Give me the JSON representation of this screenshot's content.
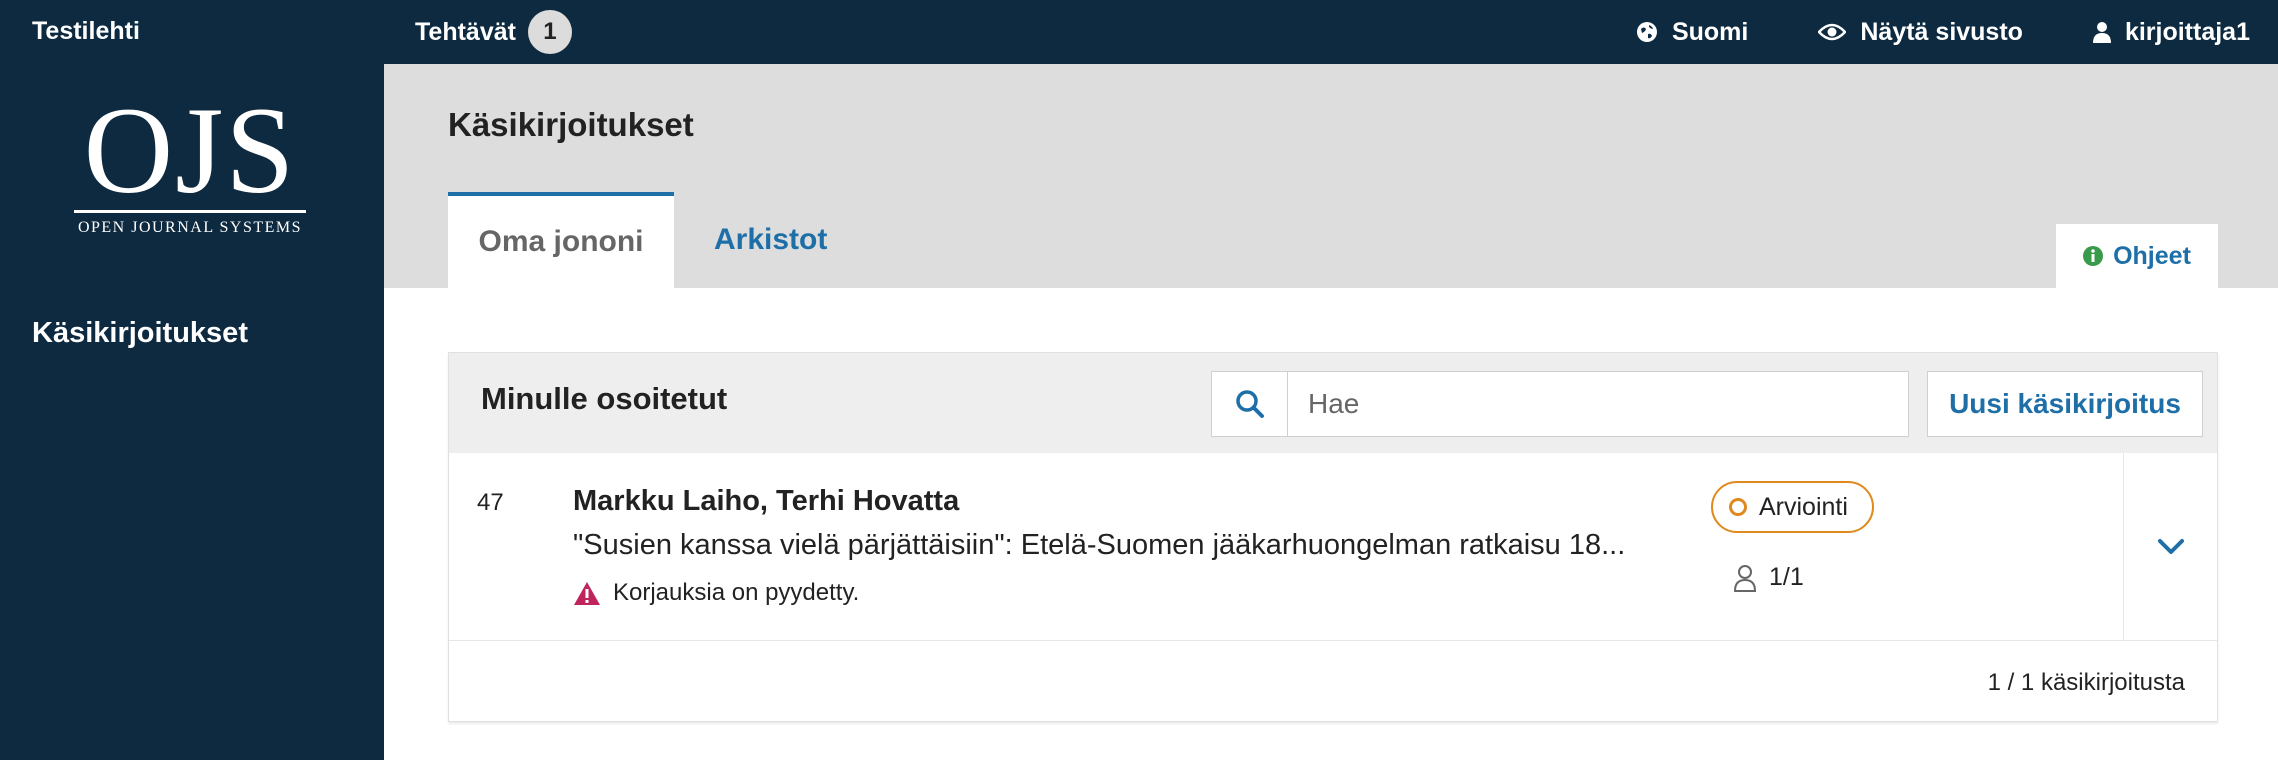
{
  "topbar": {
    "site_name": "Testilehti",
    "tasks_label": "Tehtävät",
    "tasks_count": "1",
    "language_label": "Suomi",
    "language_icon": "globe-icon",
    "view_site_label": "Näytä sivusto",
    "view_site_icon": "eye-icon",
    "user_label": "kirjoittaja1",
    "user_icon": "user-icon"
  },
  "sidebar": {
    "logo_mark": "OJS",
    "logo_text": "OPEN JOURNAL SYSTEMS",
    "nav_items": [
      {
        "label": "Käsikirjoitukset"
      }
    ]
  },
  "page": {
    "title": "Käsikirjoitukset",
    "tabs": [
      {
        "label": "Oma jononi",
        "active": true
      },
      {
        "label": "Arkistot",
        "active": false
      }
    ],
    "help_label": "Ohjeet",
    "help_icon": "info-icon"
  },
  "panel": {
    "title": "Minulle osoitetut",
    "search_placeholder": "Hae",
    "search_icon": "search-icon",
    "new_button_label": "Uusi käsikirjoitus",
    "submissions": [
      {
        "id": "47",
        "authors": "Markku Laiho, Terhi Hovatta",
        "title": "\"Susien kanssa vielä pärjättäisiin\": Etelä-Suomen jääkarhuongelman ratkaisu 18...",
        "warning": "Korjauksia on pyydetty.",
        "warning_icon": "warning-icon",
        "stage": "Arviointi",
        "participants": "1/1"
      }
    ],
    "footer_count": "1 / 1 käsikirjoitusta"
  },
  "colors": {
    "nav_dark": "#0d2a40",
    "header_gray": "#dddddd",
    "link_blue": "#1e6fa8",
    "stage_orange": "#e08a1e",
    "warning_magenta": "#c0245c"
  }
}
